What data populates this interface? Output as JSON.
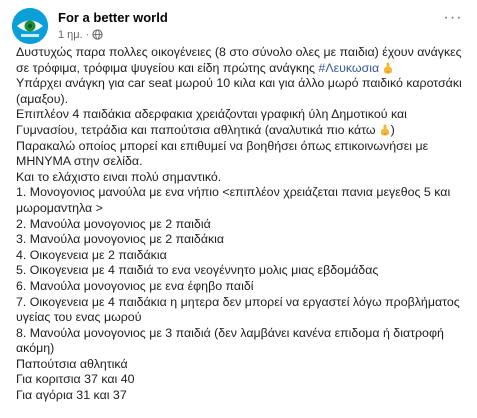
{
  "post": {
    "page_name": "For a better world",
    "time": "1 ημ.",
    "dot": "·",
    "more": "···",
    "icons": {
      "avatar": "eye-logo-icon",
      "audience": "globe-icon",
      "pointer": "pointing-down-emoji",
      "more": "more-options-icon"
    },
    "lines": {
      "l1": "Δυστυχώς παρα πολλες οικογένειες (8 στο σύνολο ολες με παιδια) έχουν ανάγκες σε τρόφιμα, τρόφιμα ψυγείου και είδη πρώτης ανάγκης",
      "hashtag": "#Λευκωσια",
      "l2": "Υπάρχει ανάγκη για car seat μωρού 10 κιλα και για άλλο μωρό παιδικό καροτσάκι (αμαξου).",
      "l3": "Επιπλέον 4 παιδάκια αδερφακια χρειάζονται γραφική ύλη Δημοτικού και Γυμνασίου, τετράδια και παπούτσια αθλητικά (αναλυτικά πιο κάτω",
      "l3_end": ")",
      "l4": "Παρακαλώ οποίος μπορεί και επιθυμεί να βοηθήσει όπως επικοινωνήσει με ΜΗΝΥΜΑ στην σελίδα.",
      "l5": "Και το ελάχιστο ειναι πολύ σημαντικό.",
      "items": [
        "1. Μονογονιος μανούλα με ενα νήπιο <επιπλέον χρειάζεται πανια μεγεθος 5 και μωρομαντηλα >",
        "2. Μανούλα μονογονιος με 2 παιδιά",
        "3. Μανούλα μονογονιος με 2 παιδάκια",
        "4. Οικογενεια με 2 παιδάκια",
        "5. Οικογενεια με 4 παιδιά το ενα νεογέννητο μολις μιας εβδομάδας",
        "6. Μανούλα μονογονιος με ενα έφηβο παιδί",
        "7. Οικογενεια με 4 παιδάκια η μητερα δεν μπορεί να εργαστεί λόγω προβλήματος υγείας του ενας μωρού",
        "8. Μανούλα μονογονιος με 3 παιδιά (δεν λαμβάνει κανένα επιδομα ή διατροφή ακόμη)"
      ],
      "shoes_title": "Παπούτσια αθλητικά",
      "girls": "Για κοριτσια 37 και 40",
      "boys": "Για αγόρια 31 και 37"
    }
  }
}
